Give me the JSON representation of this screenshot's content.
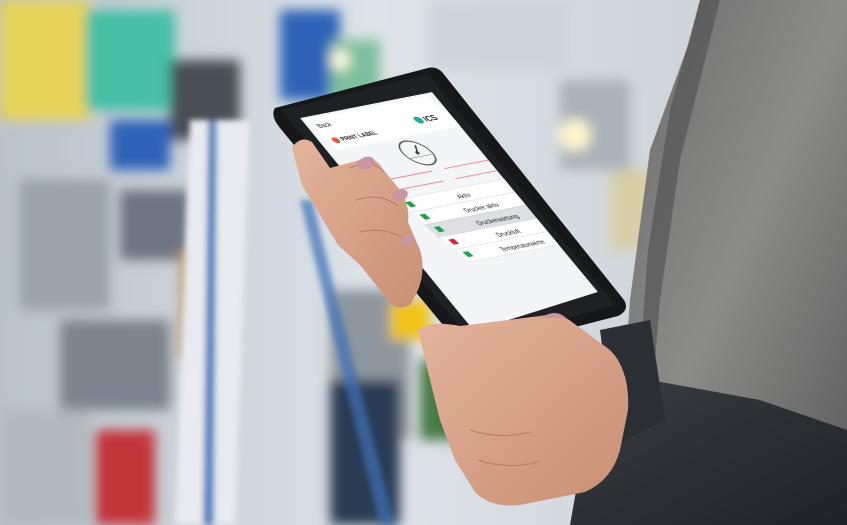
{
  "app": {
    "back_label": "Back",
    "brand_left": "PRINT LABEL",
    "brand_right": "ICS",
    "menu": [
      {
        "label": "Aktiv",
        "status": "green"
      },
      {
        "label": "Drucker aktiv",
        "status": "green"
      },
      {
        "label": "Druckerwartung",
        "status": "green"
      },
      {
        "label": "Druckluft",
        "status": "red"
      },
      {
        "label": "Temperaturwerte",
        "status": "green"
      }
    ]
  },
  "colors": {
    "green": "#1fa24a",
    "red": "#d21f3c",
    "accent": "#1f8bd6"
  }
}
